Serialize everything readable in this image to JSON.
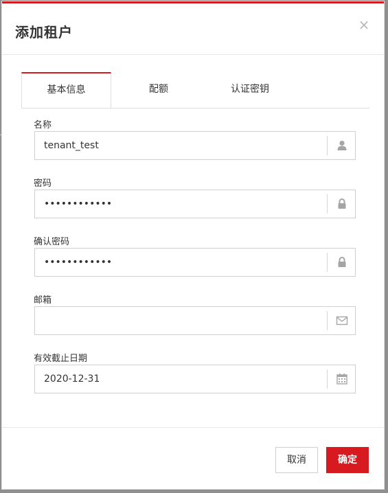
{
  "dialog": {
    "title": "添加租户",
    "close_glyph": "×"
  },
  "tabs": [
    {
      "label": "基本信息",
      "active": true
    },
    {
      "label": "配额",
      "active": false
    },
    {
      "label": "认证密钥",
      "active": false
    }
  ],
  "form": {
    "name": {
      "label": "名称",
      "value": "tenant_test",
      "icon": "user-icon"
    },
    "password": {
      "label": "密码",
      "value": "••••••••••••",
      "icon": "lock-icon"
    },
    "confirm_password": {
      "label": "确认密码",
      "value": "••••••••••••",
      "icon": "lock-icon"
    },
    "email": {
      "label": "邮箱",
      "value": "",
      "icon": "envelope-icon"
    },
    "expiry_date": {
      "label": "有效截止日期",
      "value": "2020-12-31",
      "icon": "calendar-icon"
    }
  },
  "footer": {
    "cancel_label": "取消",
    "ok_label": "确定"
  },
  "colors": {
    "accent": "#d71920",
    "backdrop": "#8f8f8f",
    "icon": "#a5a5a5"
  }
}
